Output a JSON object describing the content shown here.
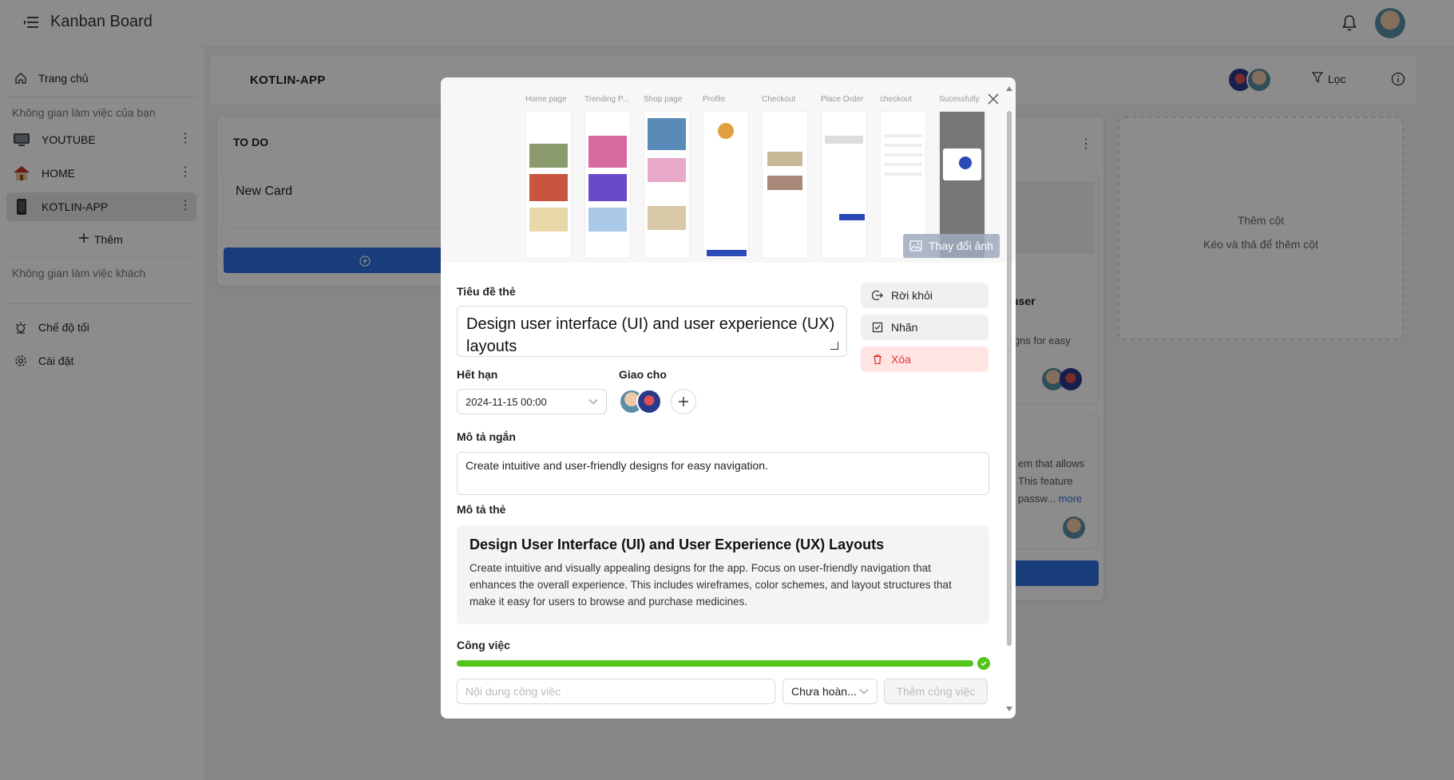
{
  "app": {
    "title": "Kanban Board"
  },
  "sidebar": {
    "home": "Trang chủ",
    "my_workspaces_heading": "Không gian làm việc của bạn",
    "workspaces": [
      {
        "name": "YOUTUBE"
      },
      {
        "name": "HOME"
      },
      {
        "name": "KOTLIN-APP"
      }
    ],
    "add_label": "Thêm",
    "guest_workspaces_heading": "Không gian làm việc khách",
    "dark_mode": "Chế độ tối",
    "settings": "Cài đặt"
  },
  "board": {
    "title": "KOTLIN-APP",
    "filter_label": "Lọc",
    "columns": [
      {
        "title": "TO DO",
        "cards": [
          {
            "title": "New Card"
          }
        ]
      }
    ],
    "background_card_fragments": {
      "title_fragment": "user",
      "desc_fragment": "igns for easy",
      "card2_line1": "em that allows",
      "card2_line2": "This feature",
      "card2_line3": "passw...",
      "more": "more"
    },
    "add_column": {
      "title": "Thêm cột",
      "hint": "Kéo và thả để thêm cột"
    }
  },
  "modal": {
    "cover_screens": [
      "Home page",
      "Trending P...",
      "Shop page",
      "Profile",
      "Checkout",
      "Place Order",
      "checkout",
      "Sucessfully"
    ],
    "change_image": "Thay đổi ảnh",
    "title_label": "Tiêu đề thẻ",
    "title_value": "Design user interface (UI) and user experience (UX) layouts",
    "actions": {
      "leave": "Rời khỏi",
      "labels": "Nhãn",
      "delete": "Xóa"
    },
    "due_label": "Hết hạn",
    "due_value": "2024-11-15 00:00",
    "assign_label": "Giao cho",
    "short_desc_label": "Mô tả ngắn",
    "short_desc_value": "Create intuitive and user-friendly designs for easy navigation.",
    "desc_label": "Mô tả thẻ",
    "desc_heading": "Design User Interface (UI) and User Experience (UX) Layouts",
    "desc_body": "Create intuitive and visually appealing designs for the app. Focus on user-friendly navigation that enhances the overall experience. This includes wireframes, color schemes, and layout structures that make it easy for users to browse and purchase medicines.",
    "tasks_label": "Công việc",
    "progress": 1.0,
    "task_placeholder": "Nội dung công việc",
    "status_value": "Chưa hoàn...",
    "add_task": "Thêm công việc"
  },
  "colors": {
    "primary": "#2f6de1",
    "success": "#52c41a",
    "danger": "#e03131"
  }
}
